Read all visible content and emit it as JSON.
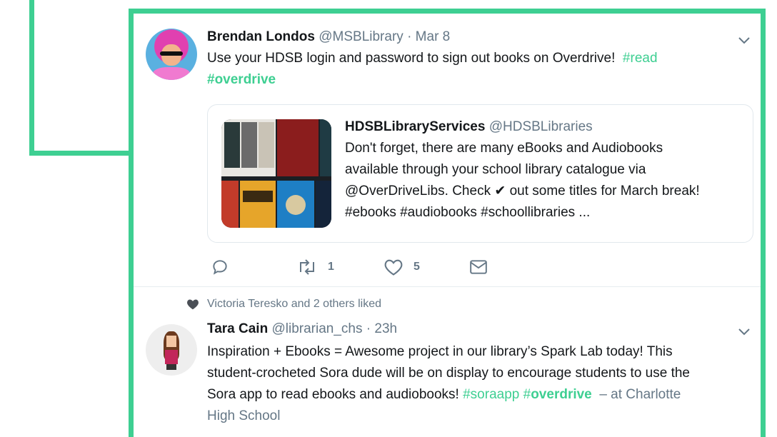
{
  "tweet1": {
    "name": "Brendan Londos",
    "handle": "@MSBLibrary",
    "sep": "·",
    "date": "Mar 8",
    "text": "Use your HDSB login and password to sign out books on Overdrive!",
    "tag_read": "#read",
    "tag_overdrive": "#overdrive",
    "quote": {
      "name": "HDSBLibraryServices",
      "handle": "@HDSBLibraries",
      "line1": "Don't forget, there are many eBooks and Audiobooks",
      "line2": "available through your school library catalogue via",
      "line3a": "@OverDriveLibs. Check",
      "check": "✔",
      "line3b": "out some titles for March break!",
      "line4": "#ebooks #audiobooks #schoollibraries ..."
    },
    "actions": {
      "reply_icon": "reply-icon",
      "retweet_icon": "retweet-icon",
      "retweet_count": "1",
      "like_icon": "heart-icon",
      "like_count": "5",
      "dm_icon": "envelope-icon"
    }
  },
  "liked_by": "Victoria Teresko and 2 others liked",
  "tweet2": {
    "name": "Tara Cain",
    "handle": "@librarian_chs",
    "sep": "·",
    "date": "23h",
    "line1": "Inspiration + Ebooks = Awesome project in our library’s Spark Lab today!  This",
    "line2": "student-crocheted Sora dude will be on display to encourage students to use the",
    "line3a": "Sora app to read ebooks and audiobooks!",
    "tag_soraapp": "#soraapp",
    "tag_overdrive_hash": "#",
    "tag_overdrive_word": "overdrive",
    "location": "– at Charlotte",
    "location2": "High School"
  },
  "colors": {
    "accent": "#3ecf92",
    "muted": "#657786",
    "text": "#14171a"
  }
}
